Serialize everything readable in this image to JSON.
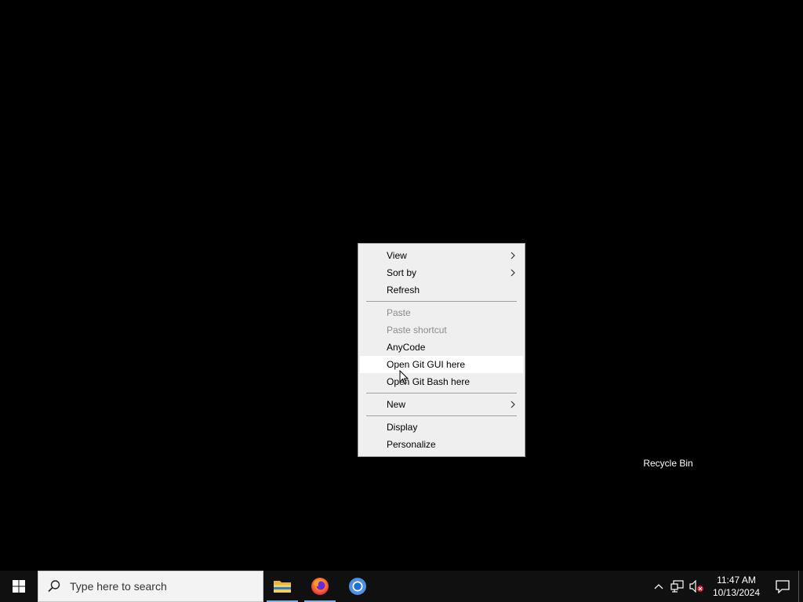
{
  "desktop": {
    "recycle_bin_label": "Recycle Bin"
  },
  "context_menu": {
    "items": [
      {
        "label": "View",
        "submenu": true,
        "enabled": true
      },
      {
        "label": "Sort by",
        "submenu": true,
        "enabled": true
      },
      {
        "label": "Refresh",
        "submenu": false,
        "enabled": true
      },
      {
        "label": "Paste",
        "submenu": false,
        "enabled": false
      },
      {
        "label": "Paste shortcut",
        "submenu": false,
        "enabled": false
      },
      {
        "label": "AnyCode",
        "submenu": false,
        "enabled": true
      },
      {
        "label": "Open Git GUI here",
        "submenu": false,
        "enabled": true,
        "highlighted": true
      },
      {
        "label": "Open Git Bash here",
        "submenu": false,
        "enabled": true
      },
      {
        "label": "New",
        "submenu": true,
        "enabled": true
      },
      {
        "label": "Display",
        "submenu": false,
        "enabled": true
      },
      {
        "label": "Personalize",
        "submenu": false,
        "enabled": true
      }
    ]
  },
  "taskbar": {
    "search_placeholder": "Type here to search",
    "apps": [
      {
        "icon": "file-explorer-icon",
        "active": true
      },
      {
        "icon": "firefox-icon",
        "active": true
      },
      {
        "icon": "chromium-icon",
        "active": false
      }
    ],
    "tray": {
      "time": "11:47 AM",
      "date": "10/13/2024",
      "icons": [
        "chevron-up-icon",
        "network-icon",
        "volume-muted-icon"
      ]
    }
  },
  "colors": {
    "desktop_bg": "#000000",
    "taskbar_bg": "#101010",
    "menu_bg": "#efefef",
    "disabled_text": "#8c8c8c",
    "active_app_indicator": "#7fb3e6"
  }
}
